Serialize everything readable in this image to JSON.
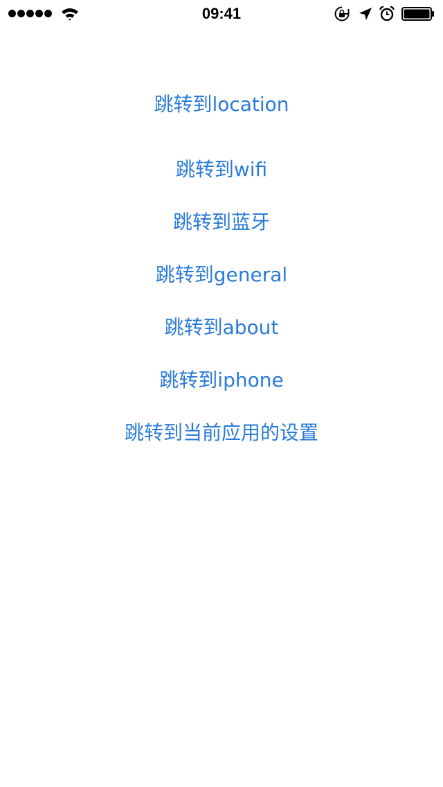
{
  "status_bar": {
    "time": "09:41",
    "signal_dots": 5,
    "icons": [
      "wifi-icon",
      "rotation-lock-icon",
      "location-arrow-icon",
      "alarm-icon",
      "battery-icon"
    ]
  },
  "menu": {
    "items": [
      {
        "label": "跳转到location"
      },
      {
        "label": "跳转到wifi"
      },
      {
        "label": "跳转到蓝牙"
      },
      {
        "label": "跳转到general"
      },
      {
        "label": "跳转到about"
      },
      {
        "label": "跳转到iphone"
      },
      {
        "label": "跳转到当前应用的设置"
      }
    ]
  },
  "colors": {
    "link": "#2a7ad8",
    "background": "#ffffff"
  }
}
